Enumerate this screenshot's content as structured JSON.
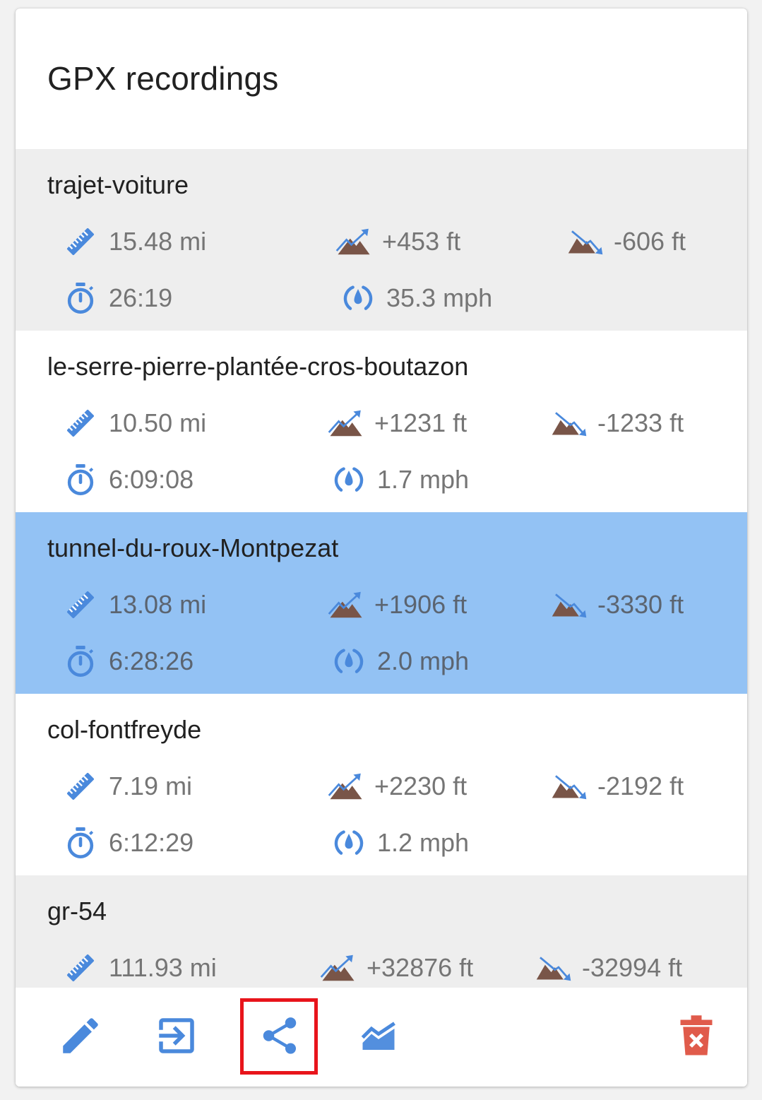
{
  "dialog": {
    "title": "GPX recordings"
  },
  "colors": {
    "accent": "#4a89dc",
    "mountain": "#795548",
    "selected_row": "#93c2f4",
    "alt_row": "#eeeeee",
    "delete": "#e05b4b",
    "highlight_box": "#e8141b"
  },
  "icons": {
    "distance": "ruler-icon",
    "ascent": "elevation-up-icon",
    "descent": "elevation-down-icon",
    "duration": "stopwatch-icon",
    "speed": "speed-gauge-icon"
  },
  "recordings": [
    {
      "name": "trajet-voiture",
      "distance": "15.48 mi",
      "ascent": "+453 ft",
      "descent": "-606 ft",
      "duration": "26:19",
      "speed": "35.3 mph",
      "style": "alt",
      "selected": false
    },
    {
      "name": "le-serre-pierre-plantée-cros-boutazon",
      "distance": "10.50 mi",
      "ascent": "+1231 ft",
      "descent": "-1233 ft",
      "duration": "6:09:08",
      "speed": "1.7 mph",
      "style": "plain",
      "selected": false
    },
    {
      "name": "tunnel-du-roux-Montpezat",
      "distance": "13.08 mi",
      "ascent": "+1906 ft",
      "descent": "-3330 ft",
      "duration": "6:28:26",
      "speed": "2.0 mph",
      "style": "selected",
      "selected": true
    },
    {
      "name": "col-fontfreyde",
      "distance": "7.19 mi",
      "ascent": "+2230 ft",
      "descent": "-2192 ft",
      "duration": "6:12:29",
      "speed": "1.2 mph",
      "style": "plain",
      "selected": false
    },
    {
      "name": "gr-54",
      "distance": "111.93 mi",
      "ascent": "+32876 ft",
      "descent": "-32994 ft",
      "duration": "",
      "speed": "",
      "style": "alt",
      "selected": false
    }
  ],
  "toolbar": {
    "buttons": [
      {
        "name": "edit-button",
        "icon": "pencil-icon"
      },
      {
        "name": "import-button",
        "icon": "import-icon"
      },
      {
        "name": "share-button",
        "icon": "share-icon",
        "highlighted": true
      },
      {
        "name": "elevation-profile-button",
        "icon": "elevation-chart-icon"
      },
      {
        "name": "delete-button",
        "icon": "trash-icon"
      }
    ]
  }
}
